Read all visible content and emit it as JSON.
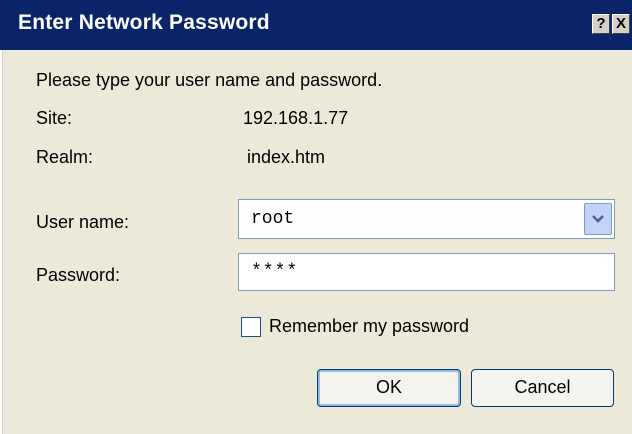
{
  "window": {
    "title": "Enter Network Password",
    "help_glyph": "?",
    "close_glyph": "X"
  },
  "form": {
    "prompt": "Please type your user name and password.",
    "site_label": "Site:",
    "site_value": "192.168.1.77",
    "realm_label": "Realm:",
    "realm_value": "index.htm",
    "username_label": "User name:",
    "username_value": "root",
    "password_label": "Password:",
    "password_value": "****",
    "remember_label": "Remember my password",
    "remember_checked": false
  },
  "buttons": {
    "ok_label": "OK",
    "cancel_label": "Cancel"
  },
  "icons": {
    "dropdown": "chevron-down-icon",
    "help": "help-icon",
    "close": "close-icon"
  },
  "colors": {
    "titlebar": "#0a246a",
    "dialog_bg": "#ece9d8",
    "input_border": "#7f9db9",
    "button_border": "#003c74"
  }
}
